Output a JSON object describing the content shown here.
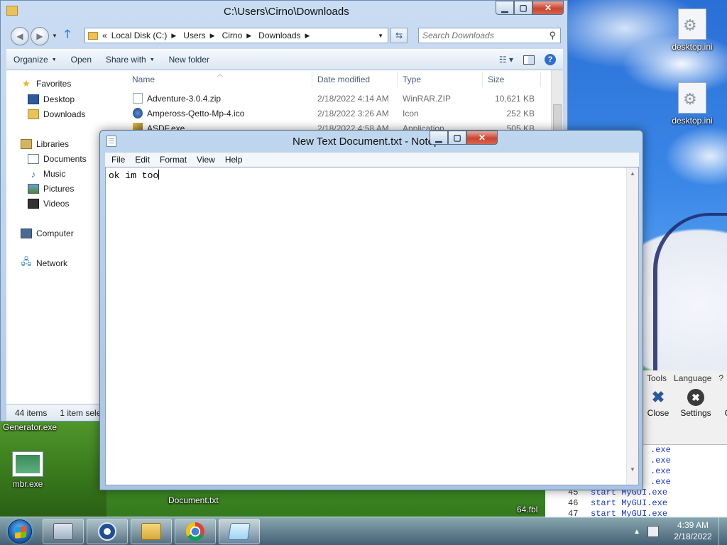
{
  "explorer": {
    "title": "C:\\Users\\Cirno\\Downloads",
    "address": {
      "prefix": "«",
      "crumbs": [
        "Local Disk (C:)",
        "Users",
        "Cirno",
        "Downloads"
      ]
    },
    "search_placeholder": "Search Downloads",
    "commands": [
      "Organize",
      "Open",
      "Share with",
      "New folder"
    ],
    "nav": {
      "favorites": "Favorites",
      "desktop": "Desktop",
      "downloads": "Downloads",
      "libraries": "Libraries",
      "documents": "Documents",
      "music": "Music",
      "pictures": "Pictures",
      "videos": "Videos",
      "computer": "Computer",
      "network": "Network"
    },
    "columns": {
      "name": "Name",
      "date": "Date modified",
      "type": "Type",
      "size": "Size"
    },
    "files": [
      {
        "name": "Adventure-3.0.4.zip",
        "date": "2/18/2022 4:14 AM",
        "type": "WinRAR.ZIP",
        "size": "10,621 KB",
        "icon": "zip-file-icon"
      },
      {
        "name": "Ampeross-Qetto-Mp-4.ico",
        "date": "2/18/2022 3:26 AM",
        "type": "Icon",
        "size": "252 KB",
        "icon": "ico-file-icon"
      },
      {
        "name": "ASDF.exe",
        "date": "2/18/2022 4:58 AM",
        "type": "Application",
        "size": "505 KB",
        "icon": "exe-file-icon"
      }
    ],
    "status": {
      "count": "44 items",
      "selected": "1 item sele"
    }
  },
  "notepad": {
    "title": "New Text Document.txt - Notepad",
    "menu": [
      "File",
      "Edit",
      "Format",
      "View",
      "Help"
    ],
    "content": "ok im too"
  },
  "background_app": {
    "menu": [
      "Tools",
      "Language",
      "?"
    ],
    "toolbar": {
      "close": "Close",
      "settings": "Settings",
      "more": "C"
    },
    "code_lines": [
      {
        "ln": "45",
        "text": "start MyGUI.exe"
      },
      {
        "ln": "46",
        "text": "start MyGUI.exe"
      },
      {
        "ln": "47",
        "text": "start MyGUI.exe"
      }
    ],
    "exe_fragments": [
      ".exe",
      ".exe",
      ".exe",
      ".exe"
    ]
  },
  "desktop": {
    "icons": [
      {
        "label": "desktop.ini"
      },
      {
        "label": "desktop.ini"
      },
      {
        "label": "mbr.exe"
      }
    ],
    "labels": {
      "generator": "Generator.exe",
      "document": "Document.txt",
      "fragment": "64.fbl"
    }
  },
  "taskbar": {
    "time": "4:39 AM",
    "date": "2/18/2022"
  }
}
